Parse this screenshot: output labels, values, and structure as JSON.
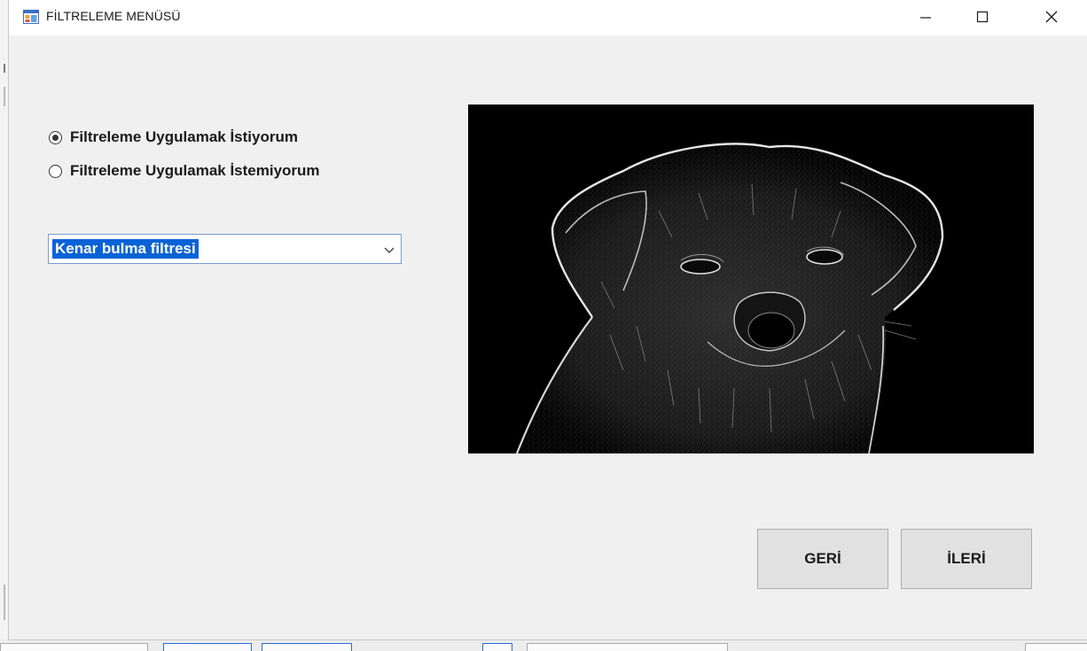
{
  "window": {
    "title": "FİLTRELEME MENÜSÜ",
    "icon": "form-app-icon",
    "controls": [
      "minimize",
      "maximize",
      "close"
    ]
  },
  "filter_options": {
    "apply_label": "Filtreleme Uygulamak İstiyorum",
    "apply_selected": true,
    "skip_label": "Filtreleme Uygulamak İstemiyorum",
    "skip_selected": false
  },
  "filter_select": {
    "value": "Kenar bulma filtresi",
    "highlighted": true
  },
  "preview": {
    "subject": "edge-filtered puppy photo",
    "background": "#000000"
  },
  "buttons": {
    "back_label": "GERİ",
    "next_label": "İLERİ"
  },
  "colors": {
    "selection": "#0a63d6",
    "window_bg": "#f0f0f0",
    "button_bg": "#e1e1e1"
  }
}
